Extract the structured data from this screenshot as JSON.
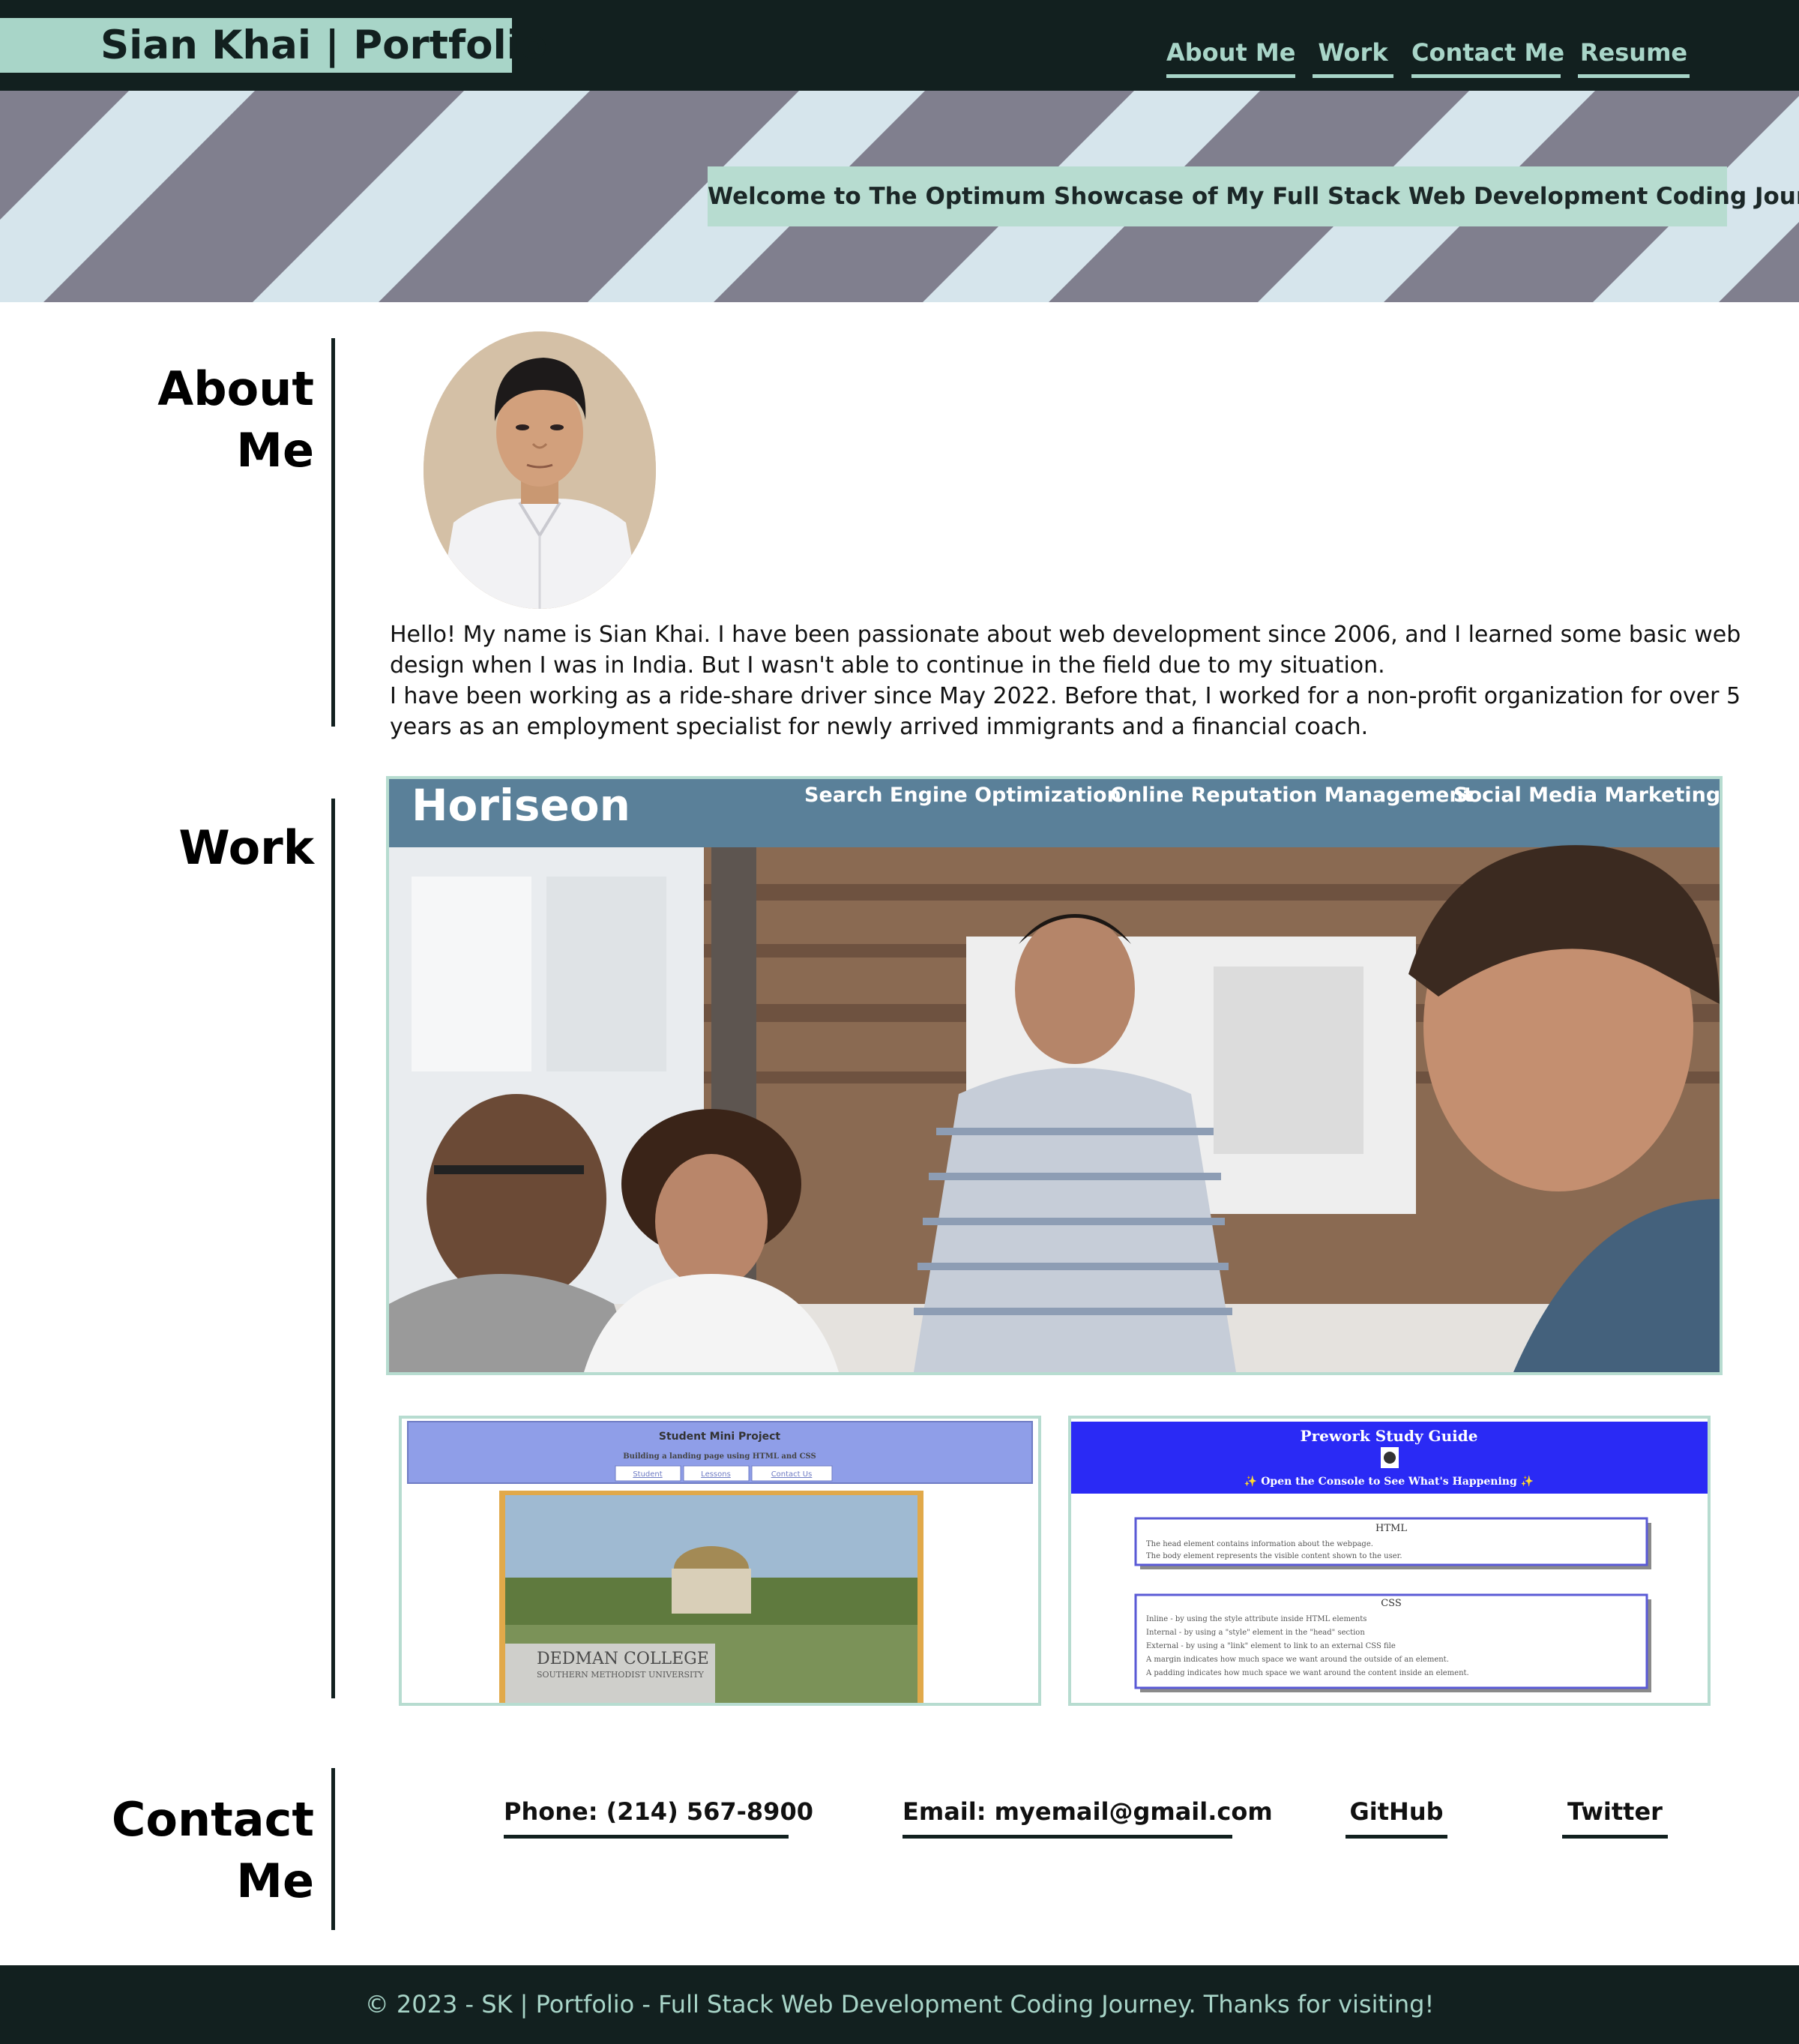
{
  "header": {
    "brand": "Sian Khai | Portfolio",
    "nav": [
      {
        "label": "About Me"
      },
      {
        "label": "Work"
      },
      {
        "label": "Contact Me"
      },
      {
        "label": "Resume"
      }
    ]
  },
  "hero": {
    "welcome": "Welcome to The Optimum Showcase of My Full Stack Web Development Coding Journey."
  },
  "about": {
    "title_line1": "About",
    "title_line2": "Me",
    "bio_p1": "Hello! My name is Sian Khai. I have been passionate about web development since 2006, and I learned some basic web design when I was in India. But I wasn't able to continue in the field due to my situation.",
    "bio_p2": "I have been working as a ride-share driver since May 2022. Before that, I worked for a non-profit organization for over 5 years as an employment specialist for newly arrived immigrants and a financial coach."
  },
  "work": {
    "title": "Work",
    "horiseon": {
      "logo": "Horiseon",
      "nav": [
        "Search Engine Optimization",
        "Online Reputation Management",
        "Social Media Marketing"
      ]
    },
    "mini_project": {
      "title": "Student Mini Project",
      "subtitle": "Building a landing page using HTML and CSS",
      "links": [
        "Student",
        "Lessons",
        "Contact Us"
      ],
      "sign_line1": "DEDMAN   COLLEGE",
      "sign_line2": "SOUTHERN METHODIST UNIVERSITY"
    },
    "prework": {
      "title": "Prework Study Guide",
      "subtitle": "✨ Open the Console to See What's Happening ✨",
      "html_heading": "HTML",
      "html_items": [
        "The head element contains information about the webpage.",
        "The body element represents the visible content shown to the user."
      ],
      "css_heading": "CSS",
      "css_items": [
        "Inline - by using the style attribute inside HTML elements",
        "Internal - by using a \"style\" element in the \"head\" section",
        "External - by using a \"link\" element to link to an external CSS file",
        "A margin indicates how much space we want around the outside of an element.",
        "A padding indicates how much space we want around the content inside an element."
      ]
    }
  },
  "contact": {
    "title_line1": "Contact",
    "title_line2": "Me",
    "links": [
      {
        "label": "Phone: (214) 567-8900"
      },
      {
        "label": "Email: myemail@gmail.com"
      },
      {
        "label": "GitHub"
      },
      {
        "label": "Twitter"
      }
    ]
  },
  "footer": {
    "text": "© 2023 - SK | Portfolio - Full Stack Web Development Coding Journey. Thanks for visiting!"
  },
  "colors": {
    "dark": "#12201f",
    "mint": "#a8d5c8",
    "hero_gray": "#807f8e",
    "hero_light": "#d6e5ec",
    "card_border": "#b7dcd0",
    "horiseon_bar": "#5a8099"
  }
}
